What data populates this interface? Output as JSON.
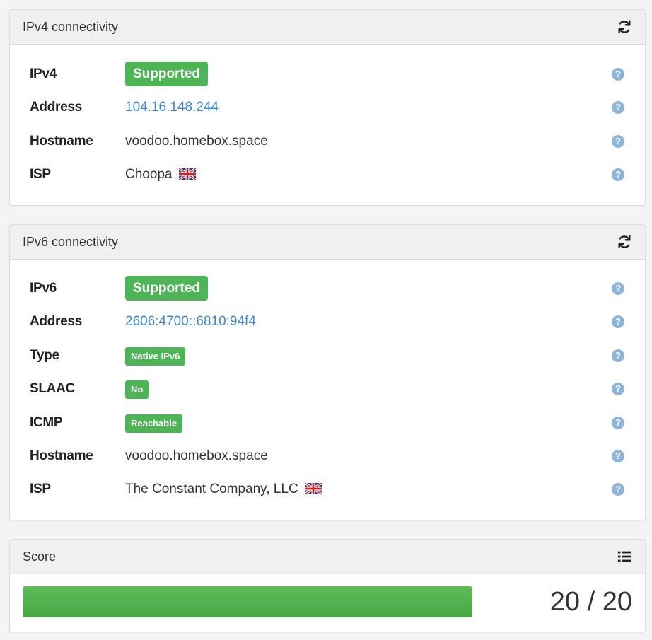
{
  "ipv4": {
    "title": "IPv4 connectivity",
    "refresh_icon": "refresh-icon",
    "rows": {
      "status": {
        "label": "IPv4",
        "value": "Supported"
      },
      "address": {
        "label": "Address",
        "value": "104.16.148.244"
      },
      "hostname": {
        "label": "Hostname",
        "value": "voodoo.homebox.space"
      },
      "isp": {
        "label": "ISP",
        "value": "Choopa",
        "flag": "gb-flag-icon"
      }
    }
  },
  "ipv6": {
    "title": "IPv6 connectivity",
    "refresh_icon": "refresh-icon",
    "rows": {
      "status": {
        "label": "IPv6",
        "value": "Supported"
      },
      "address": {
        "label": "Address",
        "value": "2606:4700::6810:94f4"
      },
      "type": {
        "label": "Type",
        "value": "Native IPv6"
      },
      "slaac": {
        "label": "SLAAC",
        "value": "No"
      },
      "icmp": {
        "label": "ICMP",
        "value": "Reachable"
      },
      "hostname": {
        "label": "Hostname",
        "value": "voodoo.homebox.space"
      },
      "isp": {
        "label": "ISP",
        "value": "The Constant Company, LLC",
        "flag": "gb-flag-icon"
      }
    }
  },
  "score": {
    "title": "Score",
    "list_icon": "list-icon",
    "progress_fraction": 1.0,
    "text": "20 / 20"
  },
  "help_glyph": "?",
  "colors": {
    "badge_green": "#4db556",
    "link_blue": "#3f87c9",
    "help_blue": "#8fb4da"
  }
}
